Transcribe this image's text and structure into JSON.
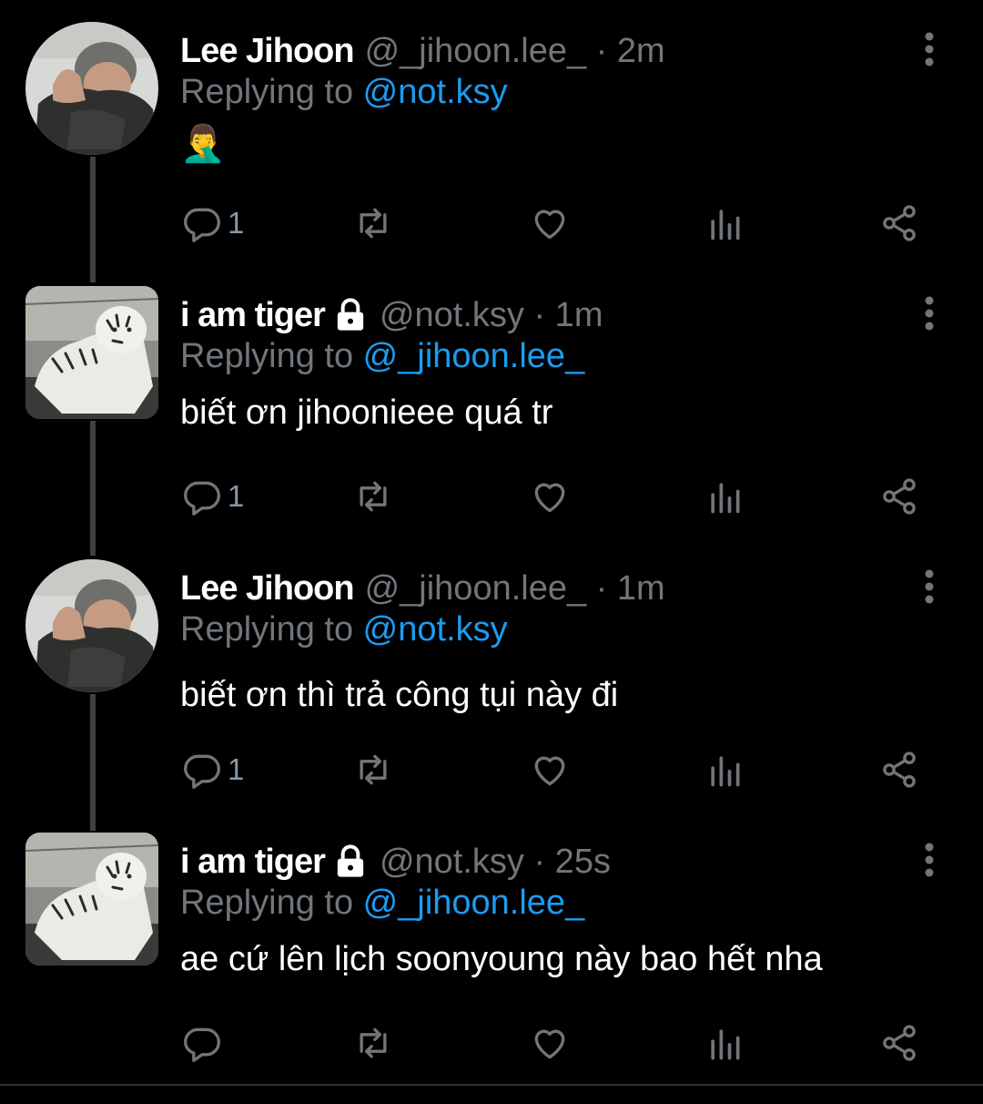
{
  "colors": {
    "background": "#000000",
    "text_primary": "#ffffff",
    "text_secondary": "#71767b",
    "link": "#1d9bf0",
    "thread_line": "#3e4144"
  },
  "tweets": [
    {
      "name": "Lee Jihoon",
      "handle_time": "@_jihoon.lee_ · 2m",
      "replying_prefix": "Replying to ",
      "replying_to": "@not.ksy",
      "text": "🤦‍♂️",
      "reply_count": "1",
      "avatar": "person-avatar",
      "locked": false
    },
    {
      "name": "i am tiger",
      "handle_time": "@not.ksy · 1m",
      "replying_prefix": "Replying to ",
      "replying_to": "@_jihoon.lee_",
      "text": "biết ơn jihoonieee quá tr",
      "reply_count": "1",
      "avatar": "tiger-avatar",
      "locked": true
    },
    {
      "name": "Lee Jihoon",
      "handle_time": "@_jihoon.lee_ · 1m",
      "replying_prefix": "Replying to ",
      "replying_to": "@not.ksy",
      "text": "biết ơn thì trả công tụi này đi",
      "reply_count": "1",
      "avatar": "person-avatar",
      "locked": false
    },
    {
      "name": "i am tiger",
      "handle_time": "@not.ksy · 25s",
      "replying_prefix": "Replying to ",
      "replying_to": "@_jihoon.lee_",
      "text": "ae cứ lên lịch soonyoung này bao hết nha",
      "reply_count": "",
      "avatar": "tiger-avatar",
      "locked": true
    }
  ],
  "icons": {
    "reply": "reply-icon",
    "retweet": "retweet-icon",
    "like": "heart-icon",
    "views": "views-icon",
    "share": "share-icon",
    "more": "more-vertical-icon",
    "lock": "lock-icon"
  }
}
